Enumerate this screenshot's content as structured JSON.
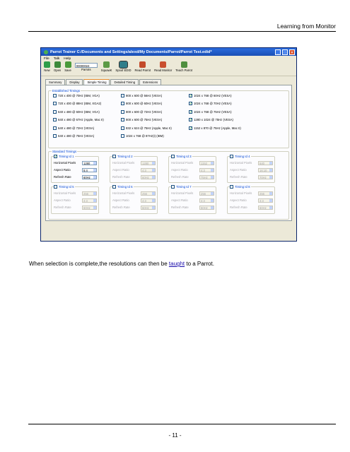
{
  "page": {
    "header": "Learning from Monitor",
    "caption_before": "When selection is complete,the resolutions can then be ",
    "caption_link": "taught",
    "caption_after": " to a Parrot.",
    "page_number": "- 11 -"
  },
  "window": {
    "title": "Parrot Trainer   C:/Documents and Settings/alexd/My Documents/Parrot/Parrot Test.edid*",
    "menu": [
      "File",
      "Talk",
      "Help"
    ],
    "toolbar": [
      "New",
      "Open",
      "Save",
      "Parrots",
      "SquawK",
      "Spoof EDID",
      "Read Parrot",
      "Read Monitor",
      "Teach Parrot"
    ],
    "parrot_select": "00000024",
    "tabs": [
      "Summary",
      "Display",
      "Simple Timing",
      "Detailed Timing",
      "Extensions"
    ],
    "active_tab": "Simple Timing"
  },
  "established": {
    "label": "Established Timings",
    "col1": [
      {
        "text": "720 x 400 @ 70Hz (IBM, VGA)",
        "checked": false
      },
      {
        "text": "720 x 400 @ 88Hz (IBM, XGA2)",
        "checked": false
      },
      {
        "text": "640 x 480 @ 60Hz (IBM, VGA)",
        "checked": false
      },
      {
        "text": "640 x 480 @ 67Hz (Apple, Mac II)",
        "checked": false
      },
      {
        "text": "640 x 480 @ 72Hz (VESA)",
        "checked": false
      },
      {
        "text": "640 x 480 @ 75Hz (VESA)",
        "checked": false
      }
    ],
    "col2": [
      {
        "text": "800 x 600 @ 56Hz (VESA)",
        "checked": false
      },
      {
        "text": "800 x 600 @ 60Hz (VESA)",
        "checked": false
      },
      {
        "text": "800 x 600 @ 72Hz (VESA)",
        "checked": false
      },
      {
        "text": "800 x 600 @ 75Hz (VESA)",
        "checked": false
      },
      {
        "text": "832 x 624 @ 75Hz (Apple, Mac II)",
        "checked": false
      },
      {
        "text": "1024 x 768 @ 87Hz(I) (IBM)",
        "checked": false
      }
    ],
    "col3": [
      {
        "text": "1024 x 768 @ 60Hz (VESA)",
        "checked": true
      },
      {
        "text": "1024 x 768 @ 70Hz (VESA)",
        "checked": true
      },
      {
        "text": "1024 x 768 @ 75Hz (VESA)",
        "checked": true
      },
      {
        "text": "1280 x 1024 @ 75Hz (VESA)",
        "checked": true
      },
      {
        "text": "1152 x 870 @ 75Hz (Apple, Mac II)",
        "checked": true
      }
    ]
  },
  "standard": {
    "label": "Standard Timings",
    "field_labels": {
      "h": "Horizontal Pixels",
      "a": "Aspect Ratio",
      "r": "Refresh Rate"
    },
    "ids": [
      {
        "label": "Timing Id 1",
        "checked": true,
        "h": "1280",
        "a": "5:4",
        "r": "60Hz"
      },
      {
        "label": "Timing Id 2",
        "checked": false,
        "h": "1280",
        "a": "4:3",
        "r": "60Hz"
      },
      {
        "label": "Timing Id 3",
        "checked": false,
        "h": "1152",
        "a": "4:3",
        "r": "75Hz"
      },
      {
        "label": "Timing Id 4",
        "checked": false,
        "h": "640",
        "a": "16:10",
        "r": "70Hz"
      },
      {
        "label": "Timing Id 5",
        "checked": false,
        "h": "256",
        "a": "4:3",
        "r": "60Hz"
      },
      {
        "label": "Timing Id 6",
        "checked": false,
        "h": "256",
        "a": "4:3",
        "r": "60Hz"
      },
      {
        "label": "Timing Id 7",
        "checked": false,
        "h": "256",
        "a": "4:3",
        "r": "60Hz"
      },
      {
        "label": "Timing Id 8",
        "checked": false,
        "h": "256",
        "a": "4:3",
        "r": "60Hz"
      }
    ]
  },
  "colors": {
    "titlebar": "#1a4fb5",
    "check": "#21a121",
    "link": "#1a0dab"
  }
}
